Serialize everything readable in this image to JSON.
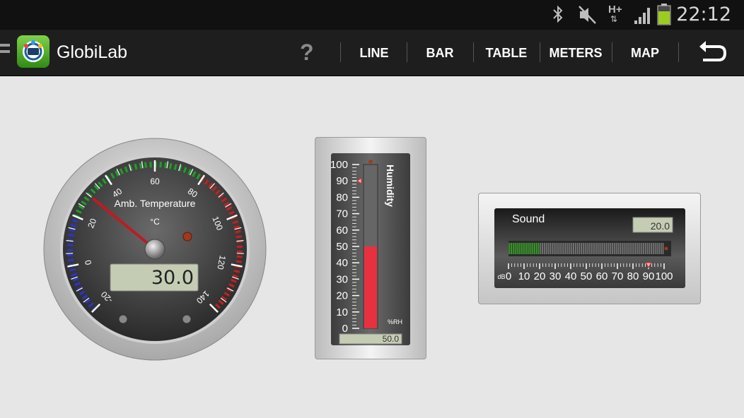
{
  "status_bar": {
    "time": "22:12",
    "network_label": "H+",
    "icons": [
      "bluetooth-icon",
      "mute-icon",
      "network-hplus-icon",
      "signal-icon",
      "battery-icon"
    ]
  },
  "app": {
    "title": "GlobiLab",
    "icon": "globilab-logo"
  },
  "toolbar": {
    "help_label": "?",
    "tabs": [
      "LINE",
      "BAR",
      "TABLE",
      "METERS",
      "MAP"
    ]
  },
  "temperature": {
    "label": "Amb. Temperature",
    "unit": "°C",
    "value": "30.0",
    "needle_value": 30,
    "scale_min": -20,
    "scale_max": 140,
    "tick_labels": [
      "-20",
      "0",
      "20",
      "40",
      "60",
      "80",
      "100",
      "120",
      "140"
    ],
    "zone_colors": {
      "low": "#2b35c8",
      "mid": "#1f9e2a",
      "high": "#c42020"
    }
  },
  "humidity": {
    "label": "Humidity",
    "unit": "%RH",
    "value": "50.0",
    "level_percent": 50,
    "marker_value": 90,
    "tick_labels": [
      "100",
      "90",
      "80",
      "70",
      "60",
      "50",
      "40",
      "30",
      "20",
      "10",
      "0"
    ],
    "bar_color": "#e83040"
  },
  "sound": {
    "label": "Sound",
    "unit": "dB",
    "value": "20.0",
    "level_value": 20,
    "marker_value": 90,
    "tick_labels": [
      "0",
      "10",
      "20",
      "30",
      "40",
      "50",
      "60",
      "70",
      "80",
      "90",
      "100"
    ],
    "bar_color": "#3aa02a"
  }
}
